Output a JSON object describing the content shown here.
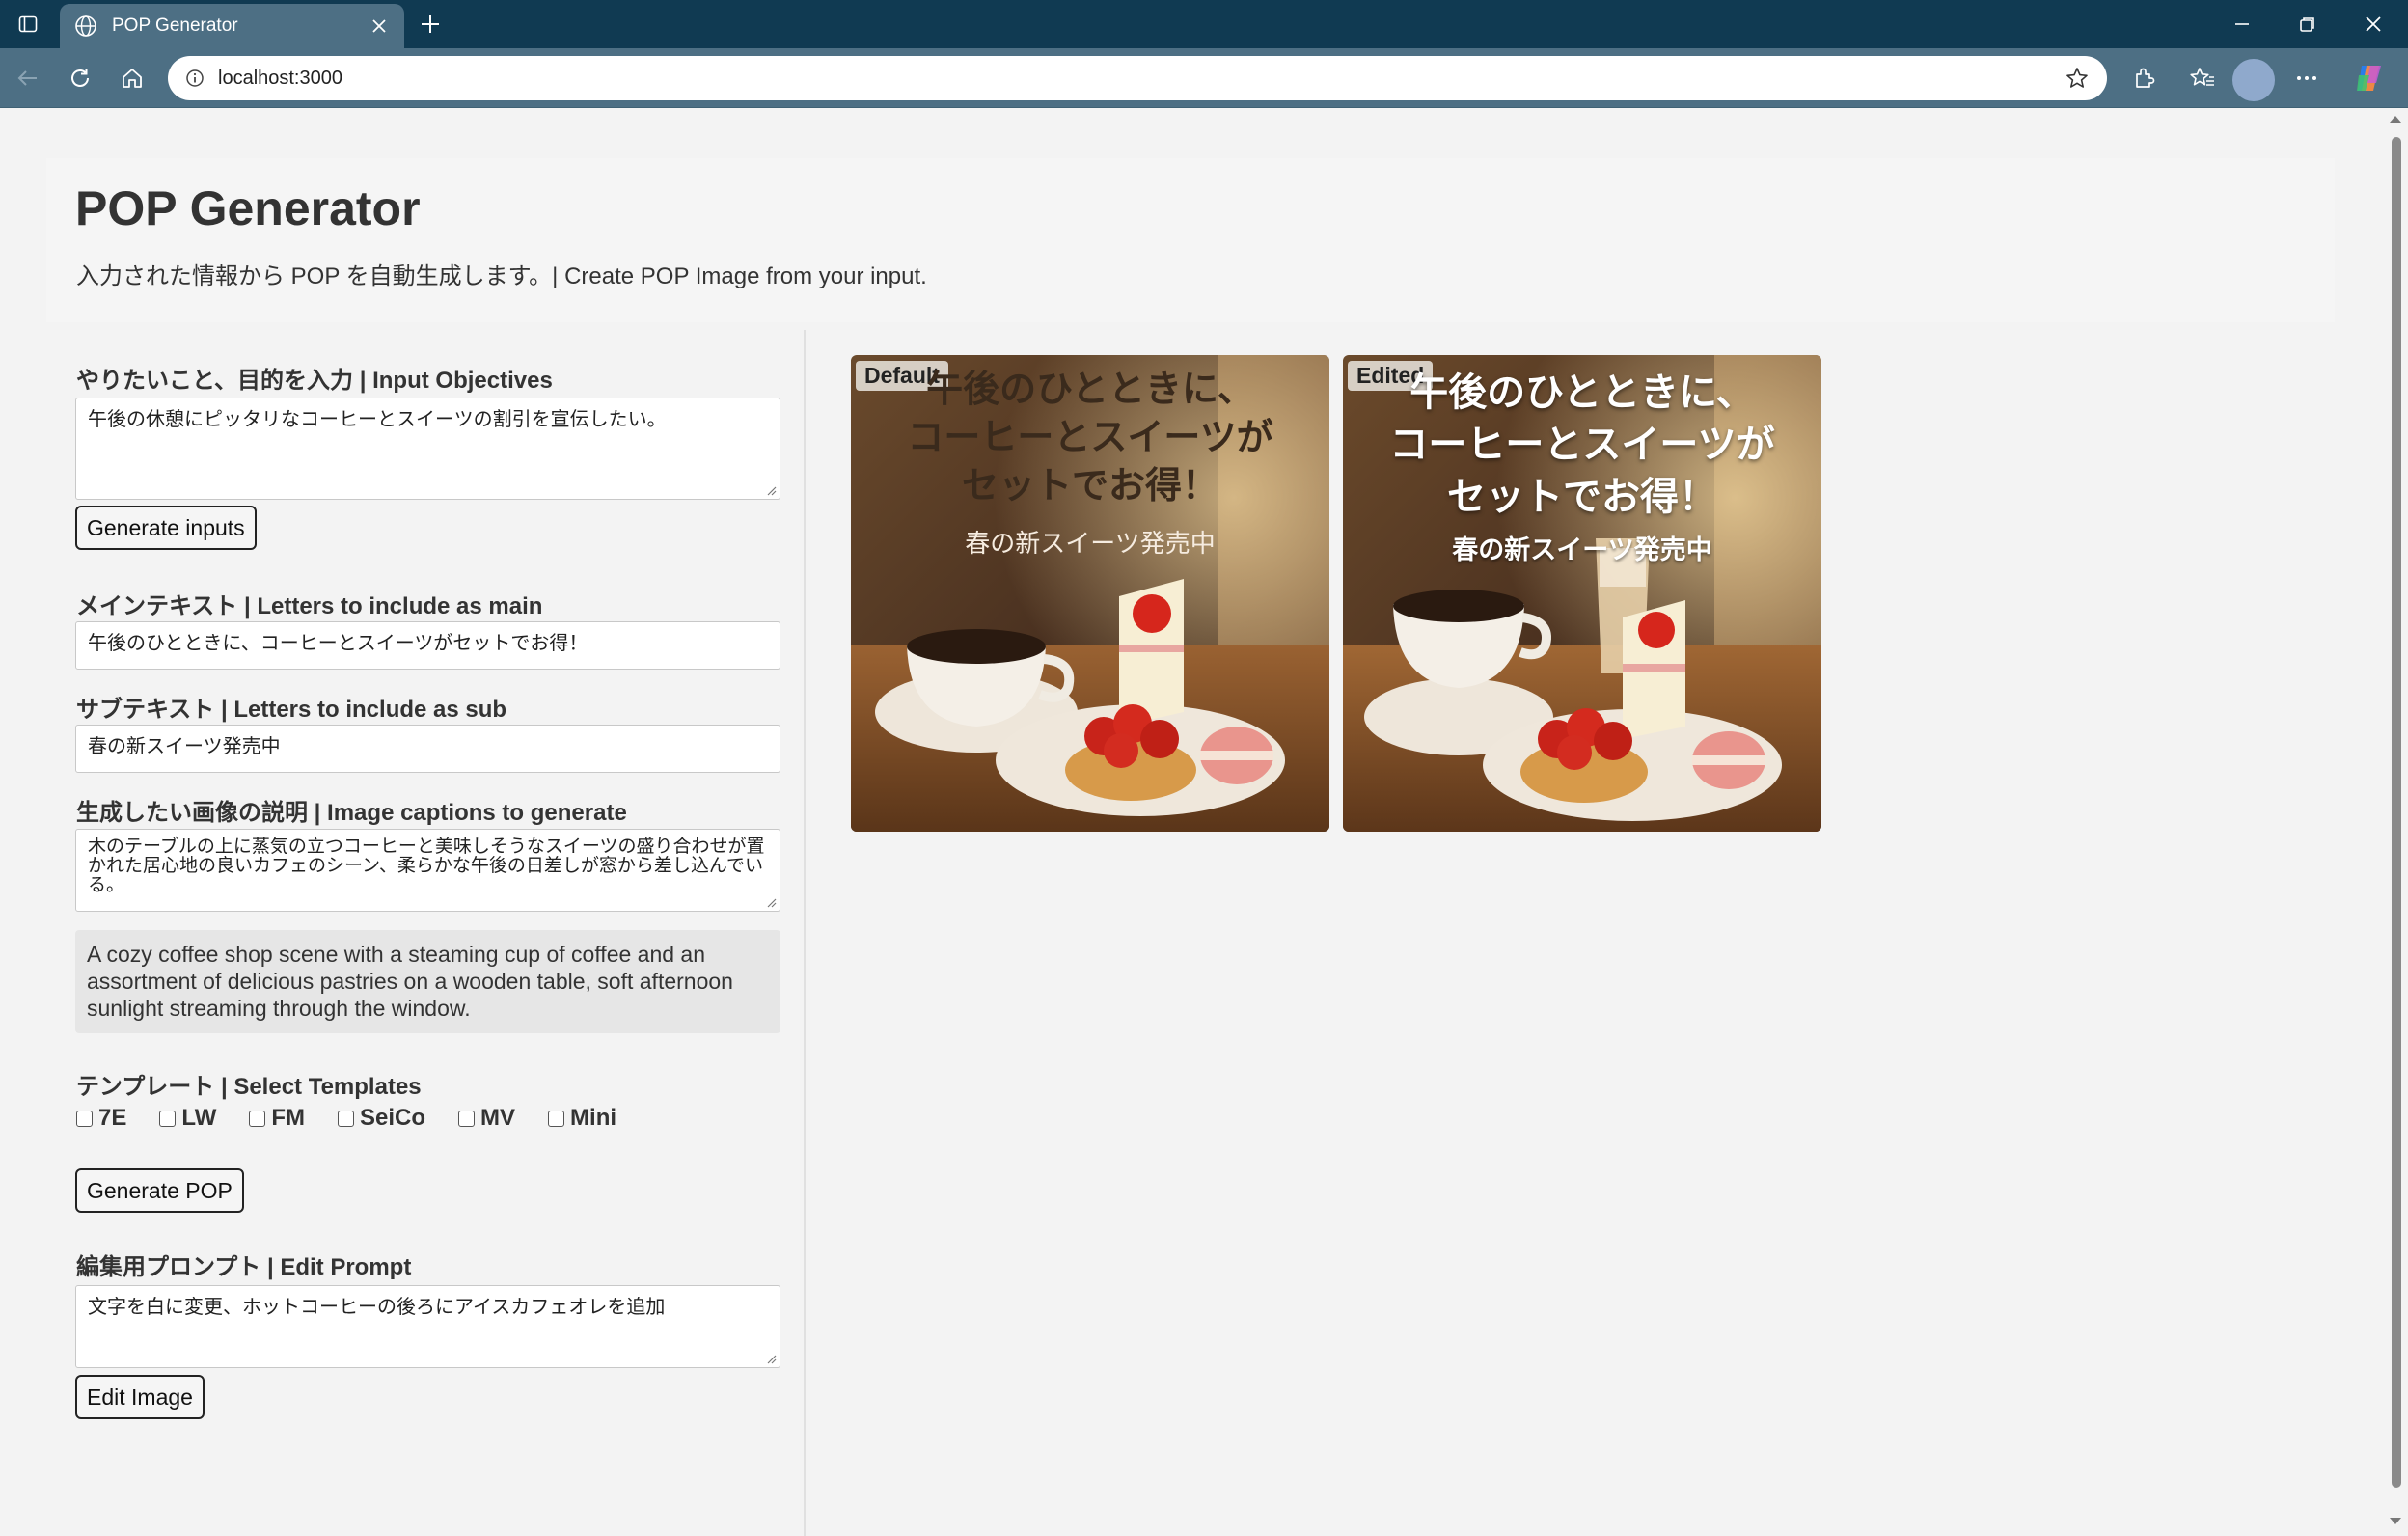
{
  "browser": {
    "tab_title": "POP Generator",
    "url": "localhost:3000"
  },
  "header": {
    "title": "POP Generator",
    "subtitle": "入力された情報から POP を自動生成します。| Create POP Image from your input."
  },
  "form": {
    "objectives_label": "やりたいこと、目的を入力 | Input Objectives",
    "objectives_value": "午後の休憩にピッタリなコーヒーとスイーツの割引を宣伝したい。",
    "generate_inputs_button": "Generate inputs",
    "main_text_label": "メインテキスト | Letters to include as main",
    "main_text_value": "午後のひとときに、コーヒーとスイーツがセットでお得！",
    "sub_text_label": "サブテキスト | Letters to include as sub",
    "sub_text_value": "春の新スイーツ発売中",
    "caption_label": "生成したい画像の説明 | Image captions to generate",
    "caption_value": "木のテーブルの上に蒸気の立つコーヒーと美味しそうなスイーツの盛り合わせが置かれた居心地の良いカフェのシーン、柔らかな午後の日差しが窓から差し込んでいる。",
    "caption_translation": "A cozy coffee shop scene with a steaming cup of coffee and an assortment of delicious pastries on a wooden table, soft afternoon sunlight streaming through the window.",
    "templates_label": "テンプレート | Select Templates",
    "templates": [
      {
        "label": "7E",
        "checked": false
      },
      {
        "label": "LW",
        "checked": false
      },
      {
        "label": "FM",
        "checked": false
      },
      {
        "label": "SeiCo",
        "checked": false
      },
      {
        "label": "MV",
        "checked": false
      },
      {
        "label": "Mini",
        "checked": false
      }
    ],
    "generate_pop_button": "Generate POP",
    "edit_prompt_label": "編集用プロンプト | Edit Prompt",
    "edit_prompt_value": "文字を白に変更、ホットコーヒーの後ろにアイスカフェオレを追加",
    "edit_image_button": "Edit Image"
  },
  "results": {
    "default": {
      "tag": "Default",
      "main_line1": "午後のひとときに、",
      "main_line2": "コーヒーとスイーツが",
      "main_line3": "セットでお得！",
      "sub": "春の新スイーツ発売中"
    },
    "edited": {
      "tag": "Edited",
      "main_line1": "午後のひとときに、",
      "main_line2": "コーヒーとスイーツが",
      "main_line3": "セットでお得！",
      "sub": "春の新スイーツ発売中"
    }
  },
  "colors": {
    "titlebar": "#103a52",
    "toolbar": "#4d6f84",
    "page_bg": "#f3f3f3"
  }
}
